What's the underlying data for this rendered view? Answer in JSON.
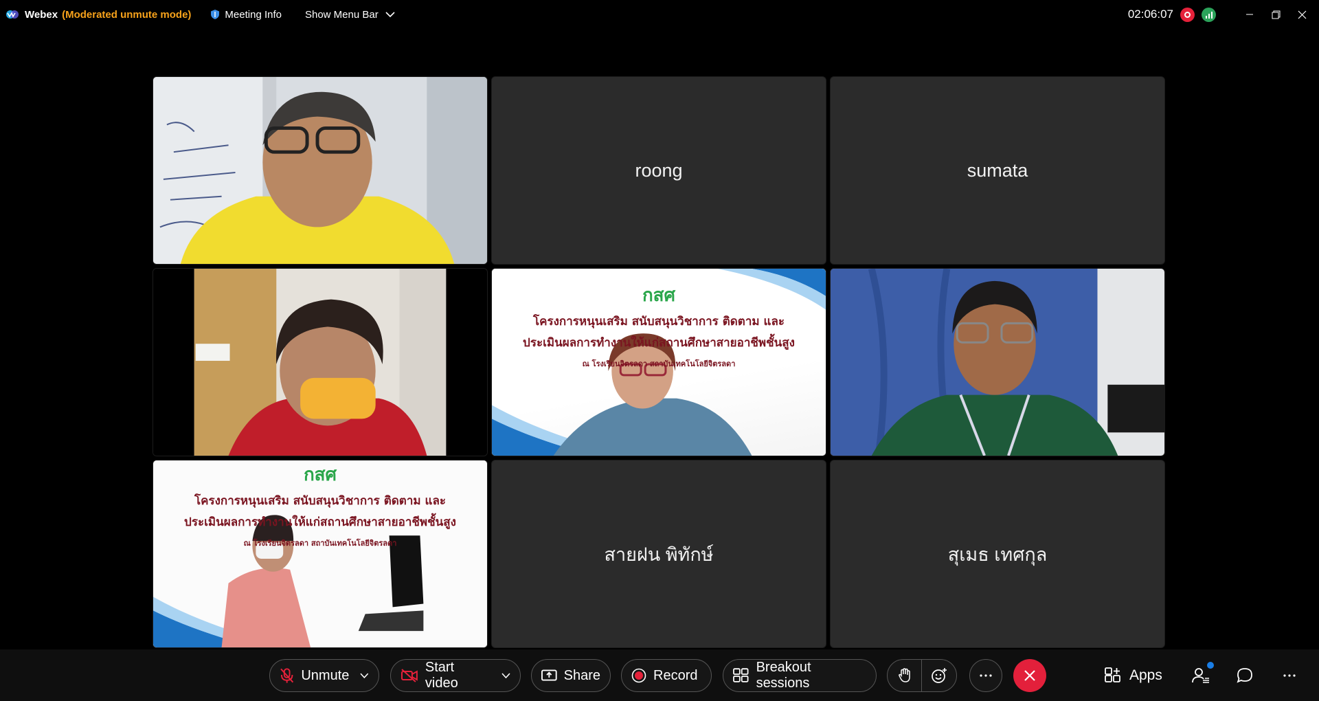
{
  "titlebar": {
    "app_name": "Webex",
    "mode": "(Moderated unmute mode)",
    "meeting_info": "Meeting Info",
    "show_menu": "Show Menu Bar",
    "clock": "02:06:07"
  },
  "participants": [
    {
      "name": "",
      "video": true
    },
    {
      "name": "roong",
      "video": false
    },
    {
      "name": "sumata",
      "video": false
    },
    {
      "name": "",
      "video": true
    },
    {
      "name": "",
      "video": true
    },
    {
      "name": "",
      "video": true
    },
    {
      "name": "",
      "video": true
    },
    {
      "name": "สายฝน พิทักษ์",
      "video": false
    },
    {
      "name": "สุเมธ เทศกุล",
      "video": false
    }
  ],
  "slide": {
    "logo_text": "กสศ",
    "line1": "โครงการหนุนเสริม สนับสนุนวิชาการ ติดตาม และ",
    "line2": "ประเมินผลการทำงานให้แก่สถานศึกษาสายอาชีพชั้นสูง",
    "line3": "ณ โรงเรียนจิตรลดา สถาบันเทคโนโลยีจิตรลดา"
  },
  "toolbar": {
    "unmute": "Unmute",
    "start_video": "Start video",
    "share": "Share",
    "record": "Record",
    "breakout": "Breakout sessions",
    "apps": "Apps"
  },
  "colors": {
    "accent_orange": "#f7a21b",
    "end_red": "#e3203b",
    "tile_bg": "#2b2b2b"
  }
}
